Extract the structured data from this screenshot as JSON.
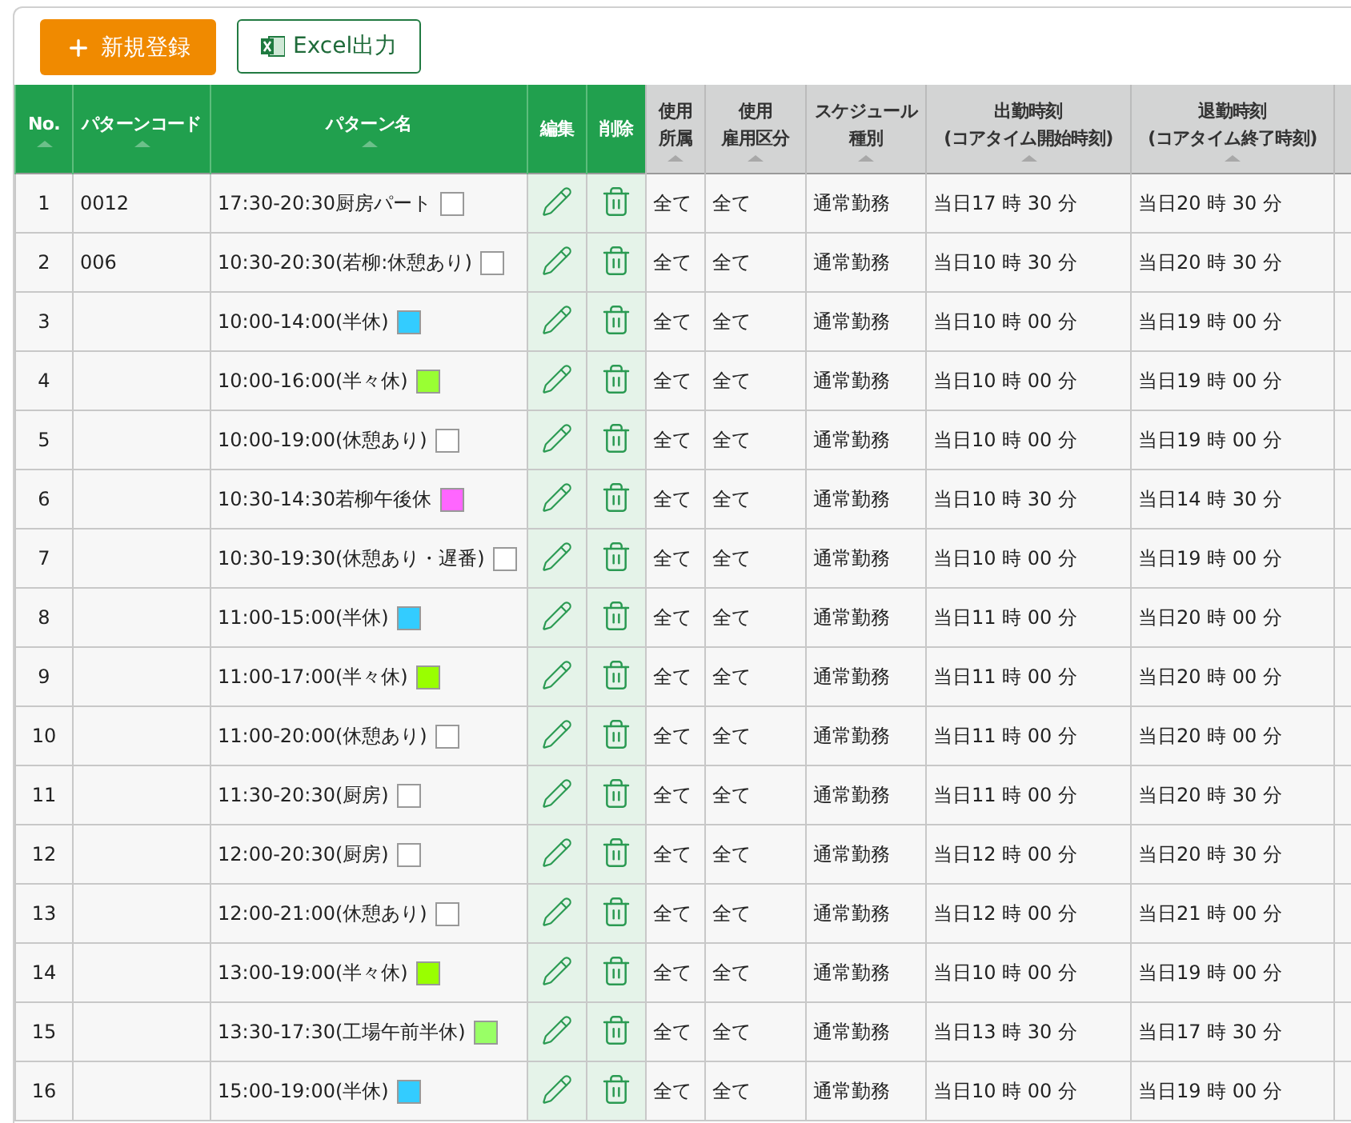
{
  "toolbar": {
    "add_button": "新規登録",
    "export_button": "Excel出力"
  },
  "table": {
    "columns": [
      {
        "label": "No.",
        "kind": "primary",
        "sortable": true
      },
      {
        "label": "パターンコード",
        "kind": "primary",
        "sortable": true
      },
      {
        "label": "パターン名",
        "kind": "primary",
        "sortable": true
      },
      {
        "label": "編集",
        "kind": "primary",
        "sortable": false
      },
      {
        "label": "削除",
        "kind": "primary",
        "sortable": false
      },
      {
        "lines": [
          "使用",
          "所属"
        ],
        "kind": "secondary",
        "sortable": true
      },
      {
        "lines": [
          "使用",
          "雇用区分"
        ],
        "kind": "secondary",
        "sortable": true
      },
      {
        "lines": [
          "スケジュール",
          "種別"
        ],
        "kind": "secondary",
        "sortable": true
      },
      {
        "lines": [
          "出勤時刻",
          "(コアタイム開始時刻)"
        ],
        "kind": "secondary",
        "sortable": true
      },
      {
        "lines": [
          "退勤時刻",
          "(コアタイム終了時刻)"
        ],
        "kind": "secondary",
        "sortable": true
      }
    ],
    "rows": [
      {
        "no": "1",
        "code": "0012",
        "name": "17:30-20:30厨房パート",
        "color": "#ffffff",
        "dept": "全て",
        "employment": "全て",
        "schedule": "通常勤務",
        "start": "当日17 時 30 分",
        "end": "当日20 時 30 分"
      },
      {
        "no": "2",
        "code": "006",
        "name": "10:30-20:30(若柳:休憩あり)",
        "color": "#ffffff",
        "dept": "全て",
        "employment": "全て",
        "schedule": "通常勤務",
        "start": "当日10 時 30 分",
        "end": "当日20 時 30 分"
      },
      {
        "no": "3",
        "name": "10:00-14:00(半休)",
        "color": "#33ccff",
        "dept": "全て",
        "employment": "全て",
        "schedule": "通常勤務",
        "start": "当日10 時 00 分",
        "end": "当日19 時 00 分"
      },
      {
        "no": "4",
        "name": "10:00-16:00(半々休)",
        "color": "#99ff33",
        "dept": "全て",
        "employment": "全て",
        "schedule": "通常勤務",
        "start": "当日10 時 00 分",
        "end": "当日19 時 00 分"
      },
      {
        "no": "5",
        "name": "10:00-19:00(休憩あり)",
        "color": "#ffffff",
        "dept": "全て",
        "employment": "全て",
        "schedule": "通常勤務",
        "start": "当日10 時 00 分",
        "end": "当日19 時 00 分"
      },
      {
        "no": "6",
        "name": "10:30-14:30若柳午後休",
        "color": "#ff66ff",
        "dept": "全て",
        "employment": "全て",
        "schedule": "通常勤務",
        "start": "当日10 時 30 分",
        "end": "当日14 時 30 分"
      },
      {
        "no": "7",
        "name": "10:30-19:30(休憩あり・遅番)",
        "color": "#ffffff",
        "dept": "全て",
        "employment": "全て",
        "schedule": "通常勤務",
        "start": "当日10 時 00 分",
        "end": "当日19 時 00 分"
      },
      {
        "no": "8",
        "name": "11:00-15:00(半休)",
        "color": "#33ccff",
        "dept": "全て",
        "employment": "全て",
        "schedule": "通常勤務",
        "start": "当日11 時 00 分",
        "end": "当日20 時 00 分"
      },
      {
        "no": "9",
        "name": "11:00-17:00(半々休)",
        "color": "#99ff00",
        "dept": "全て",
        "employment": "全て",
        "schedule": "通常勤務",
        "start": "当日11 時 00 分",
        "end": "当日20 時 00 分"
      },
      {
        "no": "10",
        "name": "11:00-20:00(休憩あり)",
        "color": "#ffffff",
        "dept": "全て",
        "employment": "全て",
        "schedule": "通常勤務",
        "start": "当日11 時 00 分",
        "end": "当日20 時 00 分"
      },
      {
        "no": "11",
        "name": "11:30-20:30(厨房)",
        "color": "#ffffff",
        "dept": "全て",
        "employment": "全て",
        "schedule": "通常勤務",
        "start": "当日11 時 00 分",
        "end": "当日20 時 30 分"
      },
      {
        "no": "12",
        "name": "12:00-20:30(厨房)",
        "color": "#ffffff",
        "dept": "全て",
        "employment": "全て",
        "schedule": "通常勤務",
        "start": "当日12 時 00 分",
        "end": "当日20 時 30 分"
      },
      {
        "no": "13",
        "name": "12:00-21:00(休憩あり)",
        "color": "#ffffff",
        "dept": "全て",
        "employment": "全て",
        "schedule": "通常勤務",
        "start": "当日12 時 00 分",
        "end": "当日21 時 00 分"
      },
      {
        "no": "14",
        "name": "13:00-19:00(半々休)",
        "color": "#99ff00",
        "dept": "全て",
        "employment": "全て",
        "schedule": "通常勤務",
        "start": "当日10 時 00 分",
        "end": "当日19 時 00 分"
      },
      {
        "no": "15",
        "name": "13:30-17:30(工場午前半休)",
        "color": "#99ff66",
        "dept": "全て",
        "employment": "全て",
        "schedule": "通常勤務",
        "start": "当日13 時 30 分",
        "end": "当日17 時 30 分"
      },
      {
        "no": "16",
        "name": "15:00-19:00(半休)",
        "color": "#33ccff",
        "dept": "全て",
        "employment": "全て",
        "schedule": "通常勤務",
        "start": "当日10 時 00 分",
        "end": "当日19 時 00 分"
      }
    ]
  }
}
